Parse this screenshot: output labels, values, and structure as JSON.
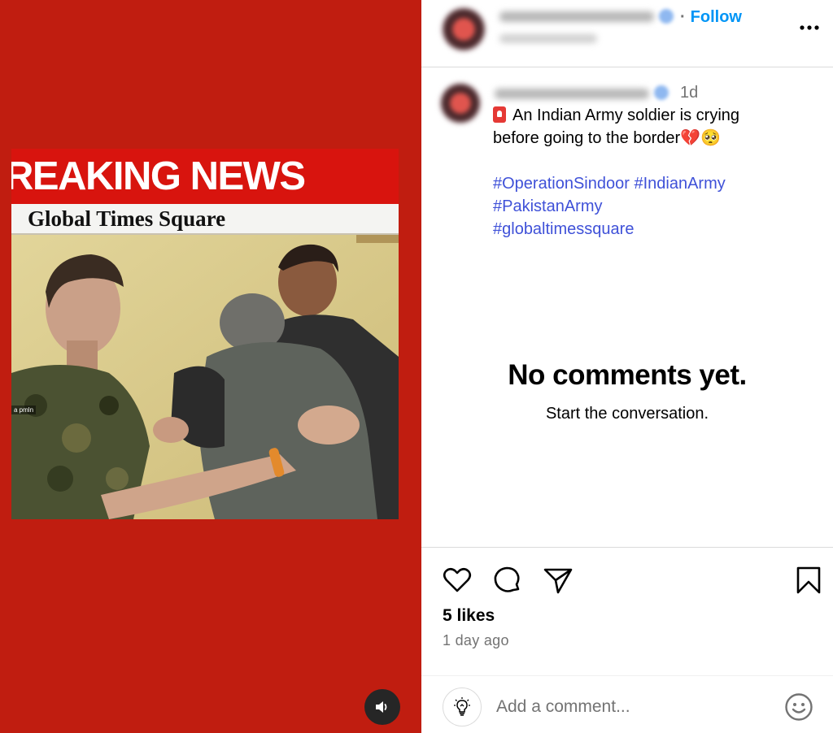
{
  "video": {
    "banner_headline": "REAKING NEWS",
    "banner_channel": "Global Times Square",
    "watermark": "a pmln",
    "mute_icon": "speaker-icon"
  },
  "header": {
    "follow_label": "Follow",
    "more_icon": "more-horizontal-icon"
  },
  "caption": {
    "timestamp": "1d",
    "line1": "An Indian Army soldier is crying",
    "line2": "before going to the border",
    "line2_emoji": "💔🥺",
    "hashtags": [
      {
        "label": "#OperationSindoor"
      },
      {
        "label": "#IndianArmy"
      },
      {
        "label": "#PakistanArmy"
      },
      {
        "label": "#globaltimessquare"
      }
    ]
  },
  "comments": {
    "empty_title": "No comments yet.",
    "empty_subtitle": "Start the conversation."
  },
  "actions": {
    "like_icon": "heart-icon",
    "comment_icon": "comment-bubble-icon",
    "share_icon": "paper-plane-icon",
    "save_icon": "bookmark-icon",
    "likes_text": "5 likes",
    "posted_ago": "1 day ago"
  },
  "comment_bar": {
    "placeholder": "Add a comment...",
    "left_icon": "lightbulb-icon",
    "right_icon": "emoji-icon"
  },
  "colors": {
    "media_background": "#c01d10",
    "breaking_banner": "#d8140e",
    "follow_blue": "#0095f6",
    "hashtag_blue": "#3f51d8",
    "muted_gray": "#737373"
  }
}
